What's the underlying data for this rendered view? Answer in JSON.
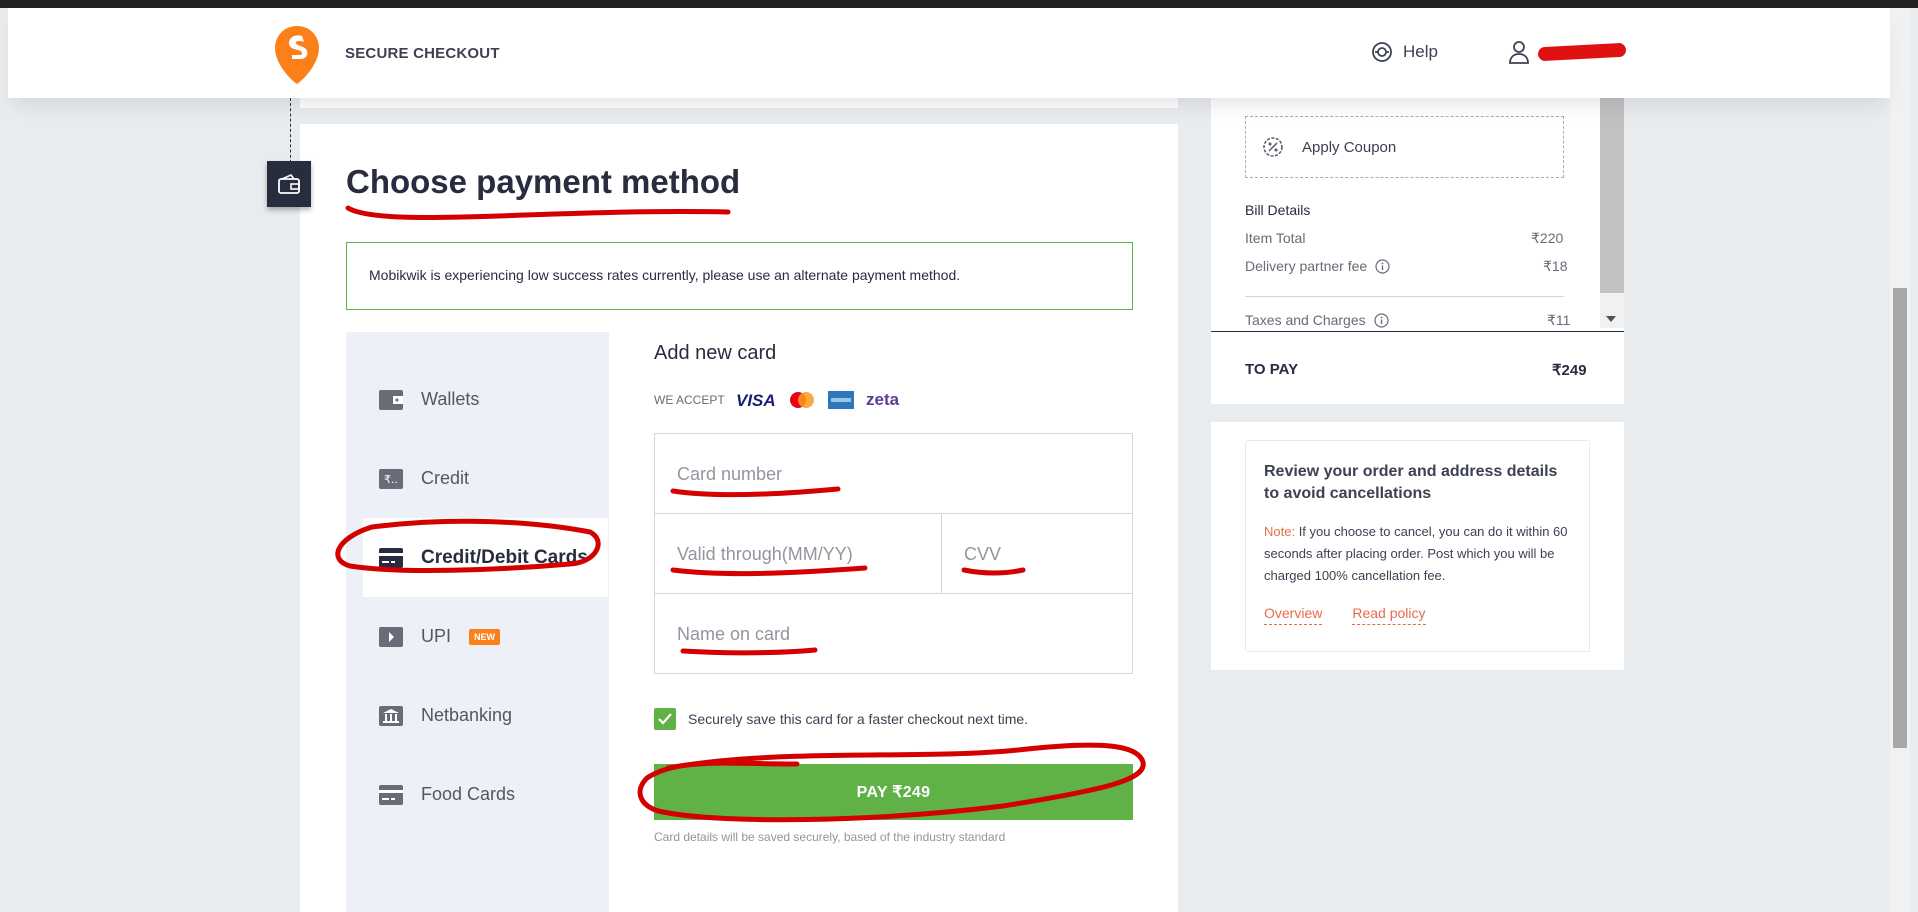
{
  "header": {
    "brand": "SECURE CHECKOUT",
    "help_label": "Help",
    "logo_icon": "swiggy-logo-icon",
    "help_icon": "lifebuoy-icon",
    "user_icon": "user-icon"
  },
  "payment": {
    "title": "Choose payment method",
    "notice": "Mobikwik is experiencing low success rates currently, please use an alternate payment method.",
    "methods": [
      {
        "label": "Wallets",
        "icon": "wallet-icon"
      },
      {
        "label": "Credit",
        "icon": "rupee-credit-icon"
      },
      {
        "label": "Credit/Debit Cards",
        "icon": "card-icon"
      },
      {
        "label": "UPI",
        "icon": "upi-icon",
        "badge": "NEW"
      },
      {
        "label": "Netbanking",
        "icon": "bank-icon"
      },
      {
        "label": "Food Cards",
        "icon": "card-icon"
      }
    ],
    "active_method": "Credit/Debit Cards"
  },
  "card_form": {
    "heading": "Add new card",
    "we_accept": "WE ACCEPT",
    "networks": [
      "VISA",
      "MasterCard",
      "American Express",
      "zeta"
    ],
    "card_number_placeholder": "Card number",
    "valid_through_placeholder": "Valid through(MM/YY)",
    "cvv_placeholder": "CVV",
    "name_placeholder": "Name on card",
    "save_label": "Securely save this card for a faster checkout next time.",
    "save_checked": true,
    "pay_label": "PAY ₹249",
    "fine_print": "Card details will be saved securely, based of the industry standard"
  },
  "bill": {
    "coupon_label": "Apply Coupon",
    "heading": "Bill Details",
    "rows": [
      {
        "label": "Item Total",
        "value": "₹220"
      },
      {
        "label": "Delivery partner fee",
        "value": "₹18"
      },
      {
        "label": "Taxes and Charges",
        "value": "₹11"
      }
    ],
    "to_pay_label": "TO PAY",
    "to_pay_value": "₹249"
  },
  "review": {
    "title": "Review your order and address details to avoid cancellations",
    "note_label": "Note:",
    "note_text": " If you choose to cancel, you can do it within 60 seconds after placing order. Post which you will be charged 100% cancellation fee.",
    "overview_link": "Overview",
    "policy_link": "Read policy"
  },
  "colors": {
    "brand": "#fc8019",
    "pay_green": "#60b246",
    "annotation_red": "#d40000",
    "note_orange": "#e46d47"
  }
}
